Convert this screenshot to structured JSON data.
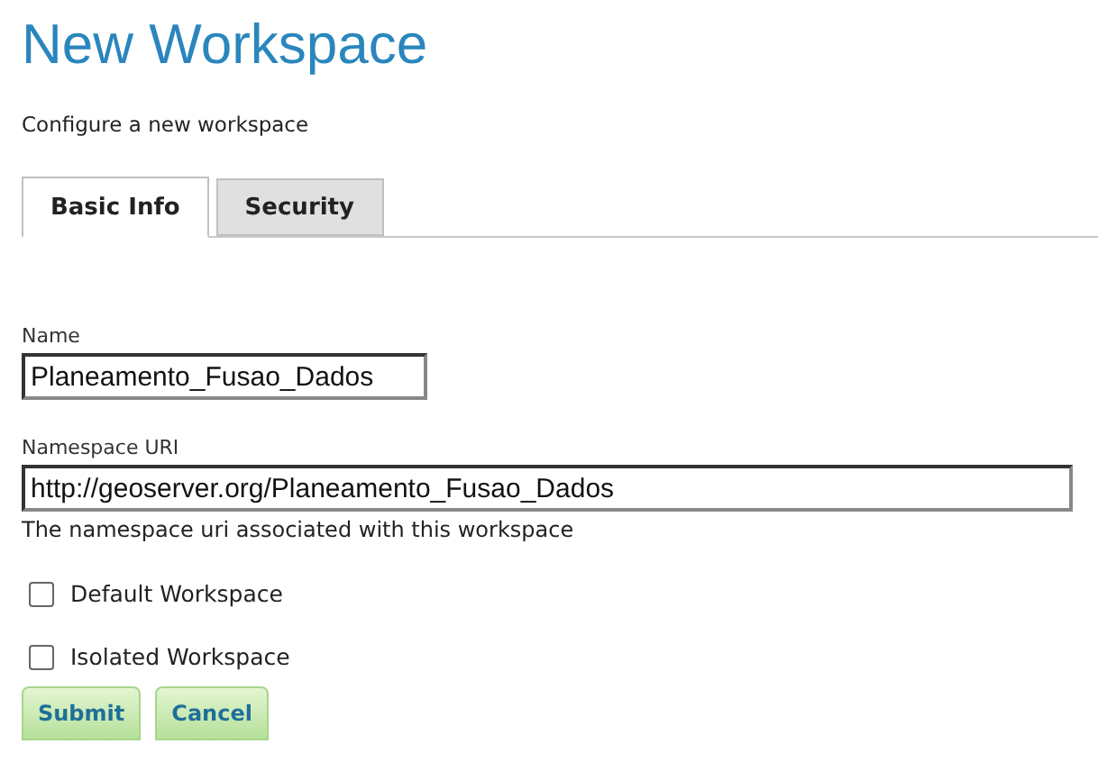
{
  "page": {
    "title": "New Workspace",
    "subtitle": "Configure a new workspace"
  },
  "tabs": [
    {
      "label": "Basic Info",
      "selected": true
    },
    {
      "label": "Security",
      "selected": false
    }
  ],
  "fields": [
    {
      "label": "Name",
      "value": "Planeamento_Fusao_Dados",
      "kind": "short"
    },
    {
      "label": "Namespace URI",
      "value": "http://geoserver.org/Planeamento_Fusao_Dados",
      "kind": "wide",
      "help": "The namespace uri associated with this workspace"
    }
  ],
  "options": [
    {
      "label": "Default Workspace",
      "checked": false
    },
    {
      "label": "Isolated Workspace",
      "checked": false
    }
  ],
  "buttons": [
    "Submit",
    "Cancel"
  ]
}
